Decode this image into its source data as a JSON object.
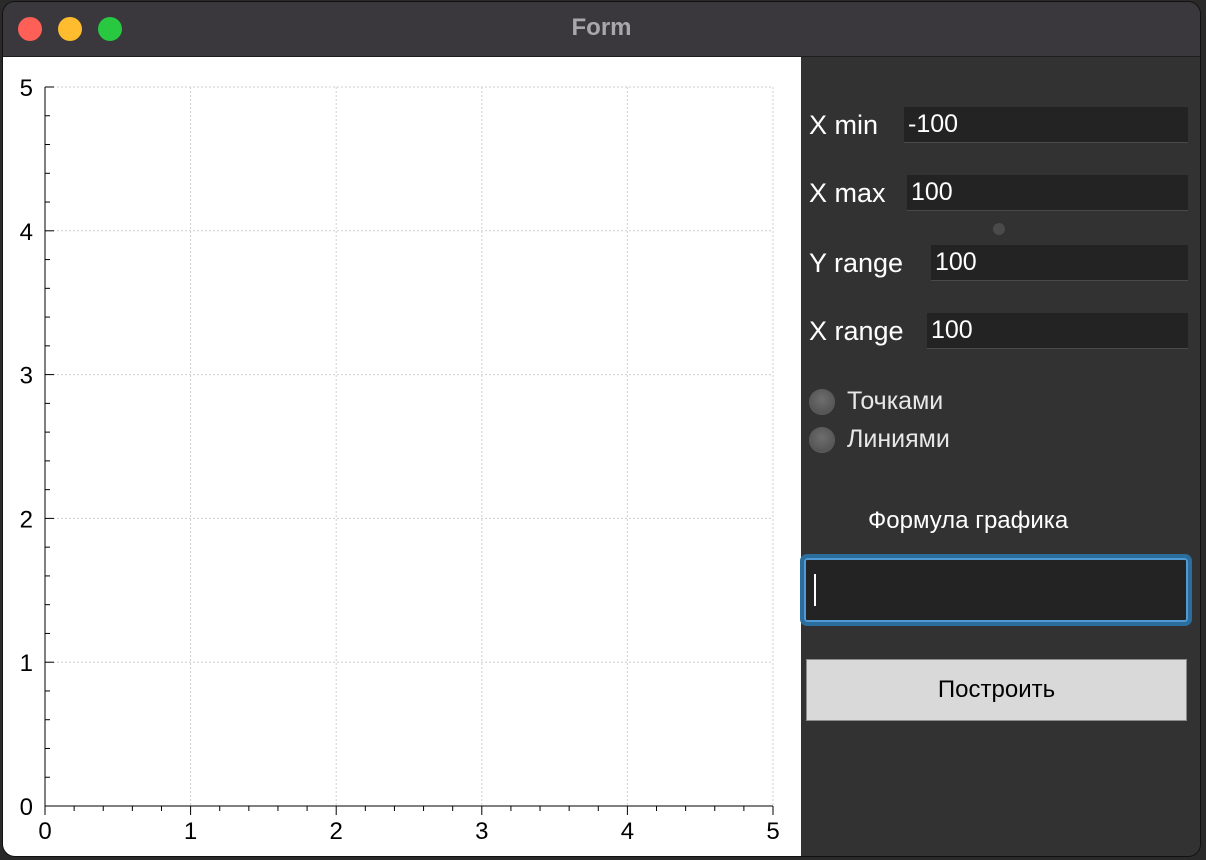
{
  "window": {
    "title": "Form"
  },
  "panel": {
    "xmin": {
      "label": "X min",
      "value": "-100"
    },
    "xmax": {
      "label": "X max",
      "value": "100"
    },
    "yrange": {
      "label": "Y range",
      "value": "100"
    },
    "xrange": {
      "label": "X range",
      "value": "100"
    },
    "radios": [
      {
        "label": "Точками"
      },
      {
        "label": "Линиями"
      }
    ],
    "formula_label": "Формула графика",
    "formula_value": "",
    "build_label": "Построить"
  },
  "chart_data": {
    "type": "line",
    "series": [],
    "xlim": [
      0,
      5
    ],
    "ylim": [
      0,
      5
    ],
    "xticks": [
      "0",
      "1",
      "2",
      "3",
      "4",
      "5"
    ],
    "yticks": [
      "0",
      "1",
      "2",
      "3",
      "4",
      "5"
    ],
    "grid": true
  }
}
